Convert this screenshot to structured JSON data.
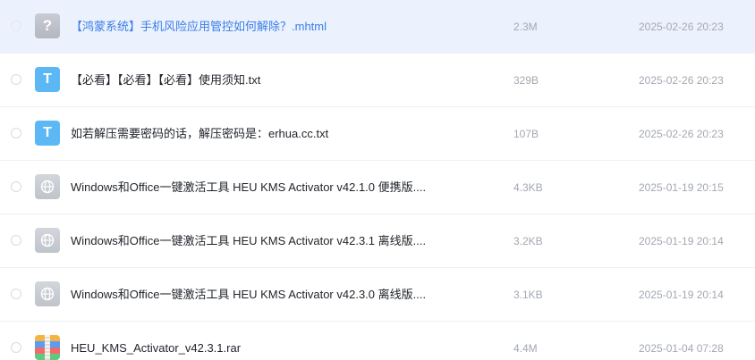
{
  "files": [
    {
      "name": "【鸿蒙系统】手机风险应用管控如何解除？.mhtml",
      "size": "2.3M",
      "date": "2025-02-26 20:23",
      "icon": "unknown-file-icon",
      "icon_glyph": "?"
    },
    {
      "name": "【必看】【必看】【必看】使用须知.txt",
      "size": "329B",
      "date": "2025-02-26 20:23",
      "icon": "text-file-icon",
      "icon_glyph": "T"
    },
    {
      "name": "如若解压需要密码的话，解压密码是：erhua.cc.txt",
      "size": "107B",
      "date": "2025-02-26 20:23",
      "icon": "text-file-icon",
      "icon_glyph": "T"
    },
    {
      "name": "Windows和Office一键激活工具 HEU KMS Activator v42.1.0 便携版....",
      "size": "4.3KB",
      "date": "2025-01-19 20:15",
      "icon": "web-file-icon"
    },
    {
      "name": "Windows和Office一键激活工具 HEU KMS Activator v42.3.1 离线版....",
      "size": "3.2KB",
      "date": "2025-01-19 20:14",
      "icon": "web-file-icon"
    },
    {
      "name": "Windows和Office一键激活工具 HEU KMS Activator v42.3.0 离线版....",
      "size": "3.1KB",
      "date": "2025-01-19 20:14",
      "icon": "web-file-icon"
    },
    {
      "name": "HEU_KMS_Activator_v42.3.1.rar",
      "size": "4.4M",
      "date": "2025-01-04 07:28",
      "icon": "archive-file-icon"
    }
  ],
  "colors": {
    "hover_row_background": "#ecf2fd",
    "hover_name_text": "#3a7ee6",
    "txt_icon": "#5cb8f5",
    "meta_text": "#a3a8b1"
  }
}
